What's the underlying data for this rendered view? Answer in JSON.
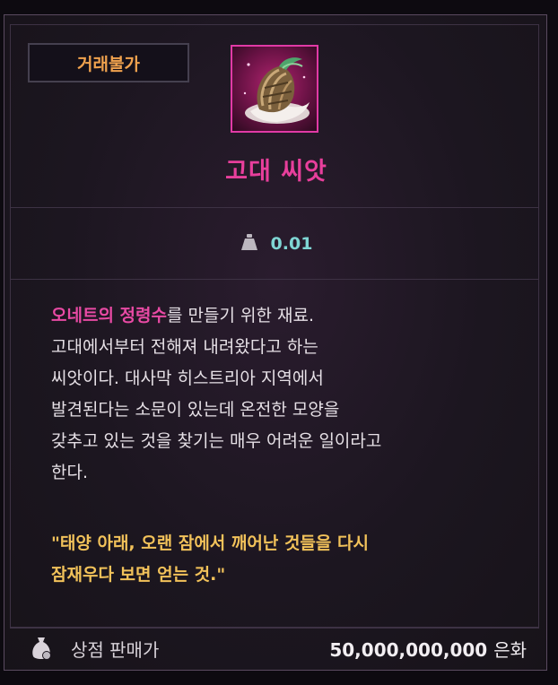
{
  "badge": "거래불가",
  "item": {
    "name": "고대 씨앗",
    "icon": "seed-icon",
    "rarity_color": "#e13aa6"
  },
  "weight": {
    "icon": "weight-icon",
    "value": "0.01"
  },
  "description": {
    "highlight": "오네트의 정령수",
    "line1_rest": "를 만들기 위한 재료.",
    "line2": "고대에서부터 전해져 내려왔다고 하는",
    "line3": "씨앗이다. 대사막 히스트리아 지역에서",
    "line4": "발견된다는 소문이 있는데 온전한 모양을",
    "line5": "갖추고 있는 것을 찾기는 매우 어려운 일이라고",
    "line6": "한다."
  },
  "quote": {
    "line1": "\"태양 아래, 오랜 잠에서 깨어난 것들을 다시",
    "line2": "잠재우다 보면 얻는 것.\""
  },
  "price": {
    "icon": "money-bag-icon",
    "label": "상점 판매가",
    "value": "50,000,000,000",
    "unit": "은화"
  }
}
